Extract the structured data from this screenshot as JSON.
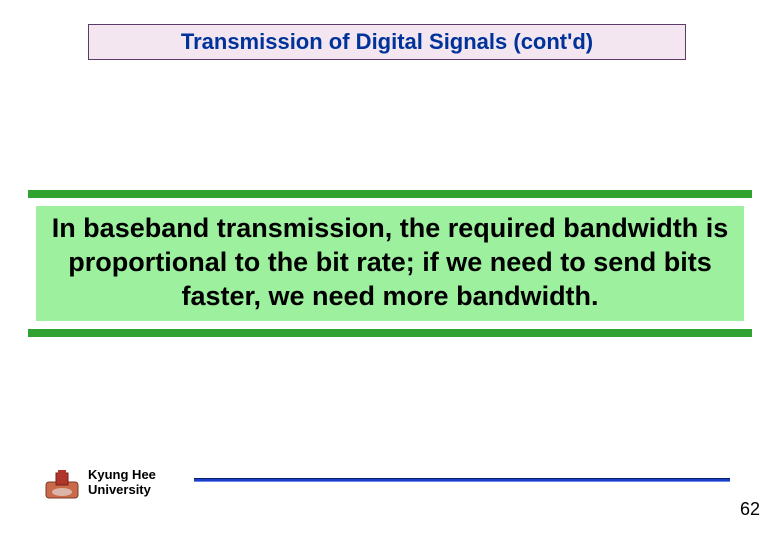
{
  "slide": {
    "title": "Transmission of Digital Signals (cont'd)",
    "callout": "In baseband transmission, the required bandwidth is proportional to the bit rate; if we need to send bits faster, we need more bandwidth."
  },
  "footer": {
    "university_line1": "Kyung Hee",
    "university_line2": "University",
    "page_number": "62"
  }
}
